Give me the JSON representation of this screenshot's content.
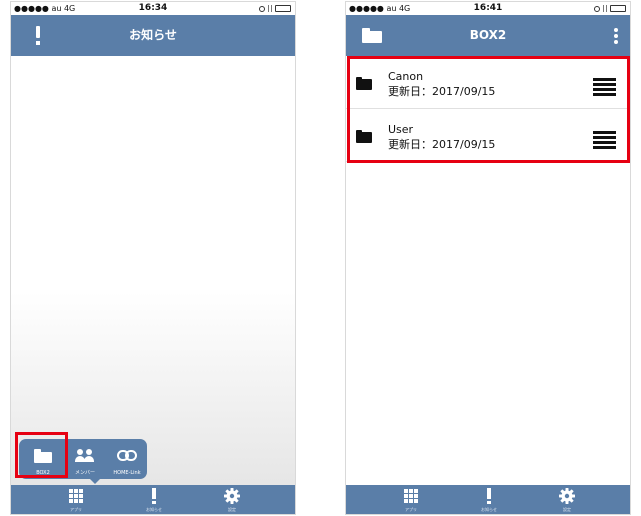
{
  "colors": {
    "accent": "#5a7ea8",
    "highlight": "#e60012",
    "battery": "#35c759"
  },
  "left_phone": {
    "status": {
      "carrier": "●●●●● au  4G",
      "time": "16:34"
    },
    "header": {
      "title": "お知らせ",
      "left_icon": "exclamation-icon"
    },
    "popup": {
      "items": [
        {
          "label": "BOX2",
          "icon": "folder-icon"
        },
        {
          "label": "メンバー",
          "icon": "people-icon"
        },
        {
          "label": "HOME-Link",
          "icon": "link-icon"
        }
      ]
    },
    "tabbar": {
      "items": [
        {
          "label": "アプリ",
          "icon": "grid-icon"
        },
        {
          "label": "お知らせ",
          "icon": "exclamation-icon"
        },
        {
          "label": "設定",
          "icon": "gear-icon"
        }
      ]
    }
  },
  "right_phone": {
    "status": {
      "carrier": "●●●●● au  4G",
      "time": "16:41"
    },
    "header": {
      "title": "BOX2",
      "left_icon": "folder-icon",
      "right_icon": "kebab-menu-icon"
    },
    "files": [
      {
        "name": "Canon",
        "date": "更新日：2017/09/15",
        "icon": "folder-icon",
        "action_icon": "menu-icon"
      },
      {
        "name": "User",
        "date": "更新日：2017/09/15",
        "icon": "folder-icon",
        "action_icon": "menu-icon"
      }
    ],
    "tabbar": {
      "items": [
        {
          "label": "アプリ",
          "icon": "grid-icon"
        },
        {
          "label": "お知らせ",
          "icon": "exclamation-icon"
        },
        {
          "label": "設定",
          "icon": "gear-icon"
        }
      ]
    }
  }
}
